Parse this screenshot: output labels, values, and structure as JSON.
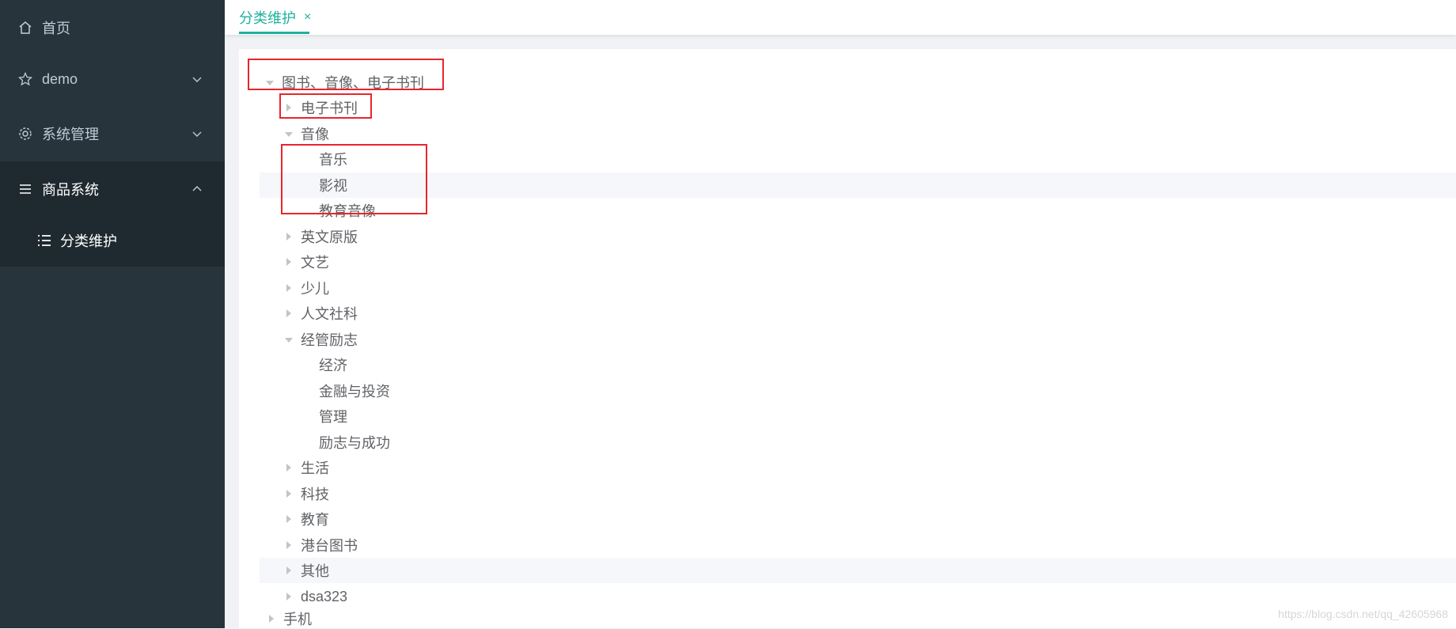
{
  "sidebar": {
    "items": [
      {
        "label": "首页",
        "icon": "home-icon"
      },
      {
        "label": "demo",
        "icon": "star-icon"
      },
      {
        "label": "系统管理",
        "icon": "gear-icon"
      },
      {
        "label": "商品系统",
        "icon": "menu-icon"
      }
    ],
    "subitem": {
      "label": "分类维护",
      "icon": "list-icon"
    }
  },
  "tabs": [
    {
      "label": "分类维护",
      "close": "×"
    }
  ],
  "tree": [
    {
      "label": "图书、音像、电子书刊",
      "level": 0,
      "expanded": true
    },
    {
      "label": "电子书刊",
      "level": 1,
      "expanded": false
    },
    {
      "label": "音像",
      "level": 1,
      "expanded": true
    },
    {
      "label": "音乐",
      "level": 2,
      "leaf": true
    },
    {
      "label": "影视",
      "level": 2,
      "leaf": true
    },
    {
      "label": "教育音像",
      "level": 2,
      "leaf": true
    },
    {
      "label": "英文原版",
      "level": 1,
      "expanded": false
    },
    {
      "label": "文艺",
      "level": 1,
      "expanded": false
    },
    {
      "label": "少儿",
      "level": 1,
      "expanded": false
    },
    {
      "label": "人文社科",
      "level": 1,
      "expanded": false
    },
    {
      "label": "经管励志",
      "level": 1,
      "expanded": true
    },
    {
      "label": "经济",
      "level": 2,
      "leaf": true
    },
    {
      "label": "金融与投资",
      "level": 2,
      "leaf": true
    },
    {
      "label": "管理",
      "level": 2,
      "leaf": true
    },
    {
      "label": "励志与成功",
      "level": 2,
      "leaf": true
    },
    {
      "label": "生活",
      "level": 1,
      "expanded": false
    },
    {
      "label": "科技",
      "level": 1,
      "expanded": false
    },
    {
      "label": "教育",
      "level": 1,
      "expanded": false
    },
    {
      "label": "港台图书",
      "level": 1,
      "expanded": false
    },
    {
      "label": "其他",
      "level": 1,
      "expanded": false
    },
    {
      "label": "dsa323",
      "level": 1,
      "expanded": false
    },
    {
      "label": "手机",
      "level": 0,
      "expanded": false
    }
  ],
  "watermark": "https://blog.csdn.net/qq_42605968",
  "colors": {
    "sidebar_bg": "#28343b",
    "accent": "#1fb19e",
    "highlight_box": "#e8262c"
  }
}
